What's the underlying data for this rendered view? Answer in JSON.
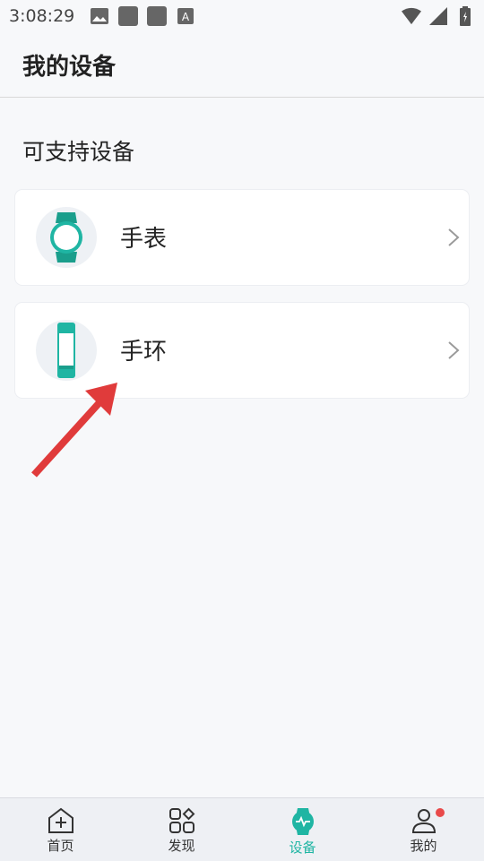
{
  "status_bar": {
    "time": "3:08:29",
    "icons_left": [
      "image-icon",
      "square-icon",
      "square-icon",
      "font-icon"
    ],
    "icons_right": [
      "wifi-icon",
      "signal-icon",
      "battery-icon"
    ]
  },
  "header": {
    "title": "我的设备"
  },
  "section": {
    "title": "可支持设备"
  },
  "devices": [
    {
      "label": "手表",
      "icon": "watch-icon"
    },
    {
      "label": "手环",
      "icon": "band-icon"
    }
  ],
  "bottom_nav": {
    "items": [
      {
        "label": "首页",
        "icon": "home-icon",
        "active": false
      },
      {
        "label": "发现",
        "icon": "discover-icon",
        "active": false
      },
      {
        "label": "设备",
        "icon": "device-icon",
        "active": true
      },
      {
        "label": "我的",
        "icon": "profile-icon",
        "active": false
      }
    ]
  },
  "colors": {
    "accent": "#1fb5a3",
    "arrow": "#e03b3b",
    "badge": "#e94a4a"
  }
}
